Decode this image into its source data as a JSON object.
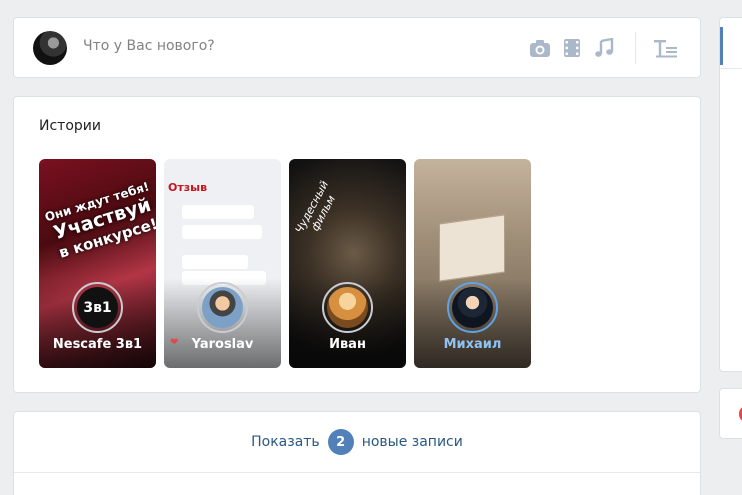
{
  "composer": {
    "placeholder": "Что у Вас нового?",
    "icons": [
      "camera-icon",
      "video-icon",
      "music-icon",
      "text-format-icon"
    ]
  },
  "stories": {
    "title": "Истории",
    "items": [
      {
        "name": "Nescafe 3в1",
        "seen": true,
        "avatar_text": "3в1",
        "promo": [
          "Они ждут тебя!",
          "Участвуй",
          "в конкурсе!"
        ]
      },
      {
        "name": "Yaroslav",
        "seen": true,
        "header": "Отзыв"
      },
      {
        "name": "Иван",
        "seen": true,
        "caption": [
          "Чудесный",
          "фильм"
        ]
      },
      {
        "name": "Михаил",
        "seen": false
      }
    ]
  },
  "new_posts": {
    "prefix": "Показать",
    "count": "2",
    "suffix": "новые записи"
  },
  "colors": {
    "accent": "#5181b8",
    "link": "#2a5885",
    "unseen_ring": "#5ea3e8",
    "icon": "#aab8c9",
    "background": "#edeef0"
  }
}
